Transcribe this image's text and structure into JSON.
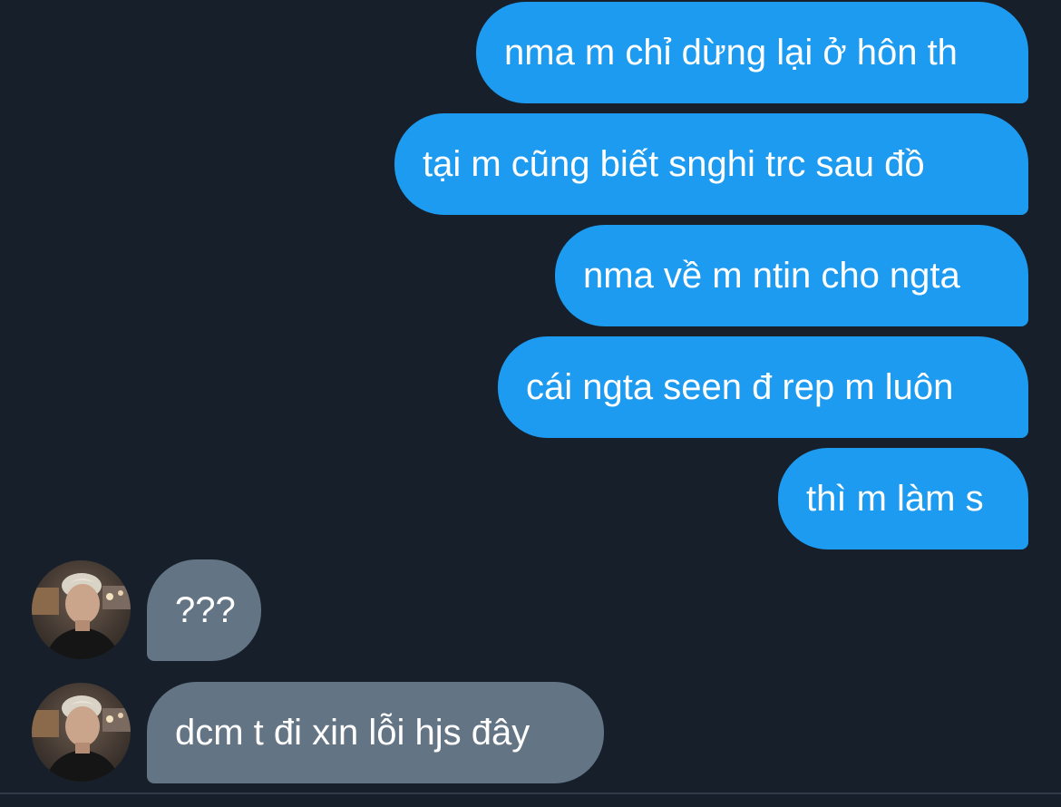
{
  "conversation": {
    "sent": [
      {
        "text": "nma m chỉ dừng lại ở hôn th"
      },
      {
        "text": "tại m cũng biết snghi trc sau đồ"
      },
      {
        "text": "nma về m ntin cho ngta"
      },
      {
        "text": "cái ngta seen đ rep m luôn"
      },
      {
        "text": "thì m làm s"
      }
    ],
    "received": [
      {
        "text": "???"
      },
      {
        "text": "dcm t đi xin lỗi hjs đây"
      }
    ]
  },
  "colors": {
    "background": "#17202a",
    "sent_bubble": "#1d9bf0",
    "received_bubble": "#637484",
    "text": "#ffffff"
  },
  "icons": {
    "avatar": "user-avatar-photo"
  }
}
